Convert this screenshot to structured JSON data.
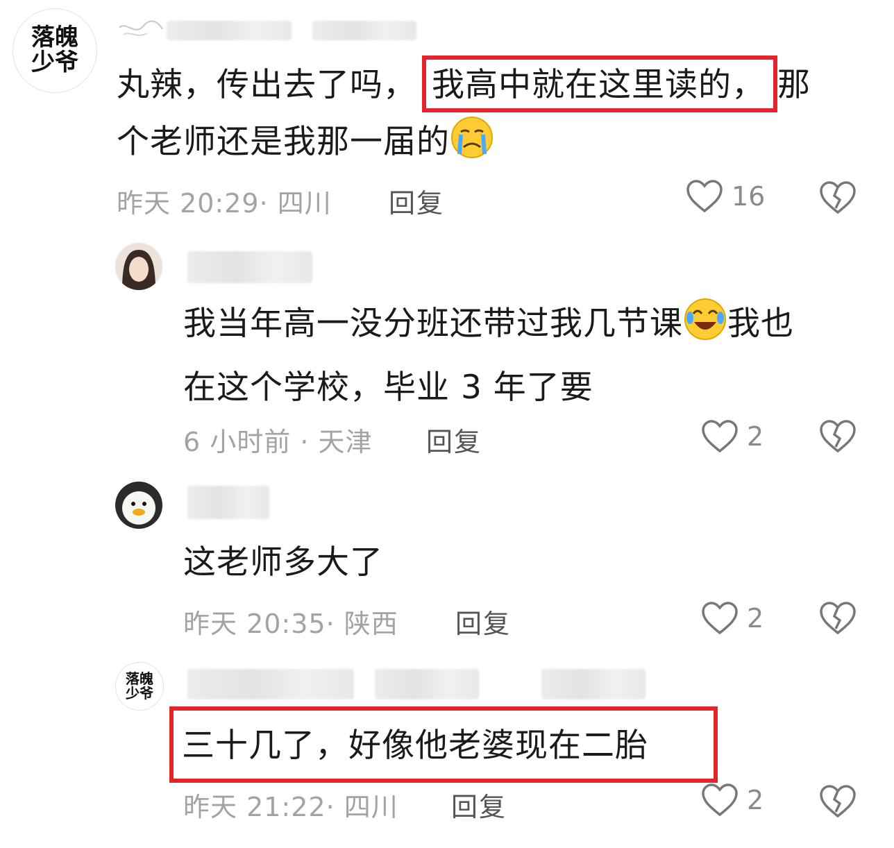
{
  "colors": {
    "highlight": "#e4232b",
    "meta": "#a3a3a3",
    "text": "#1a1a1a"
  },
  "comments": [
    {
      "avatar_label": [
        "落魄",
        "少爷"
      ],
      "line1_pre": "丸辣，传出去了吗，",
      "line1_highlight": "我高中就在这里读的，",
      "line1_post": "那",
      "line2": "个老师还是我那一届的",
      "emoji": "crying-face",
      "meta": "昨天 20:29· 四川",
      "reply": "回复",
      "likes": "16"
    },
    {
      "avatar": "girl-photo",
      "line1_pre": "我当年高一没分班还带过我几节课",
      "line1_post": "我也",
      "line2": "在这个学校，毕业 3 年了要",
      "emoji": "laughing-tears-face",
      "meta": "6 小时前 · 天津",
      "reply": "回复",
      "likes": "2"
    },
    {
      "avatar": "duck-photo",
      "line1": "这老师多大了",
      "meta": "昨天 20:35· 陕西",
      "reply": "回复",
      "likes": "2"
    },
    {
      "avatar_label": [
        "落魄",
        "少爷"
      ],
      "line1": "三十几了，好像他老婆现在二胎",
      "meta": "昨天 21:22· 四川",
      "reply": "回复",
      "likes": "2"
    }
  ]
}
